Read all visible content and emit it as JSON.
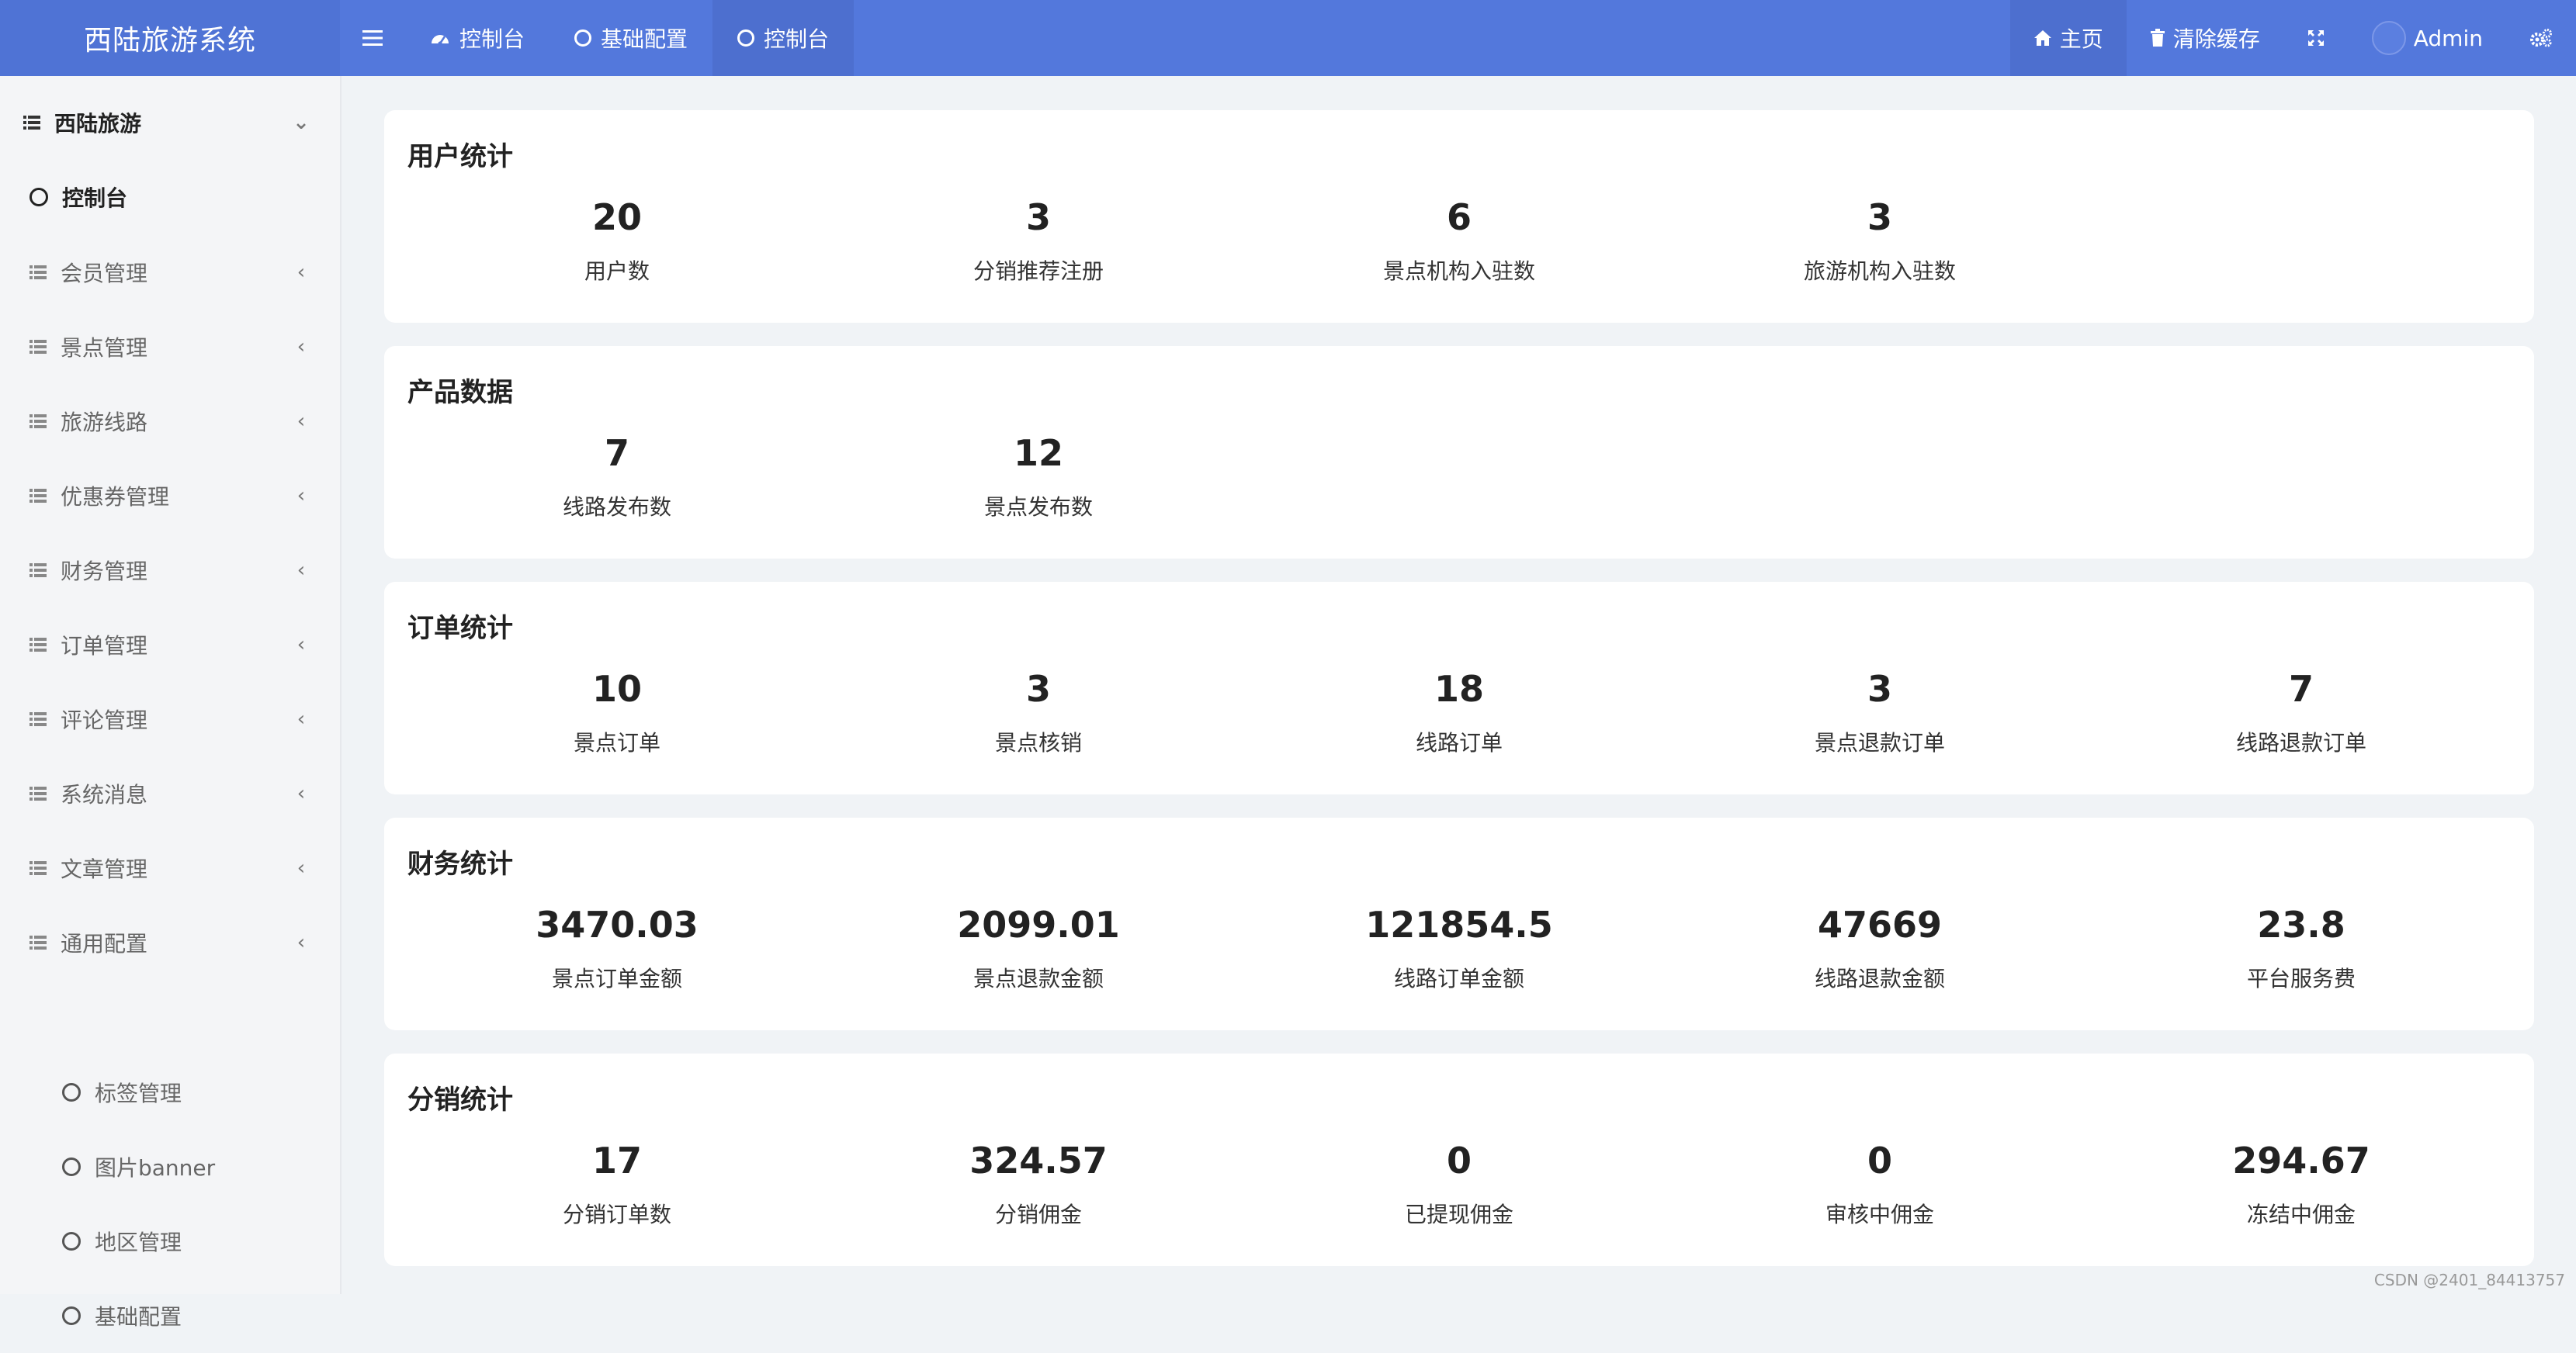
{
  "app": {
    "title": "西陆旅游系统"
  },
  "header": {
    "tabs": [
      {
        "label": "控制台",
        "icon": "dashboard-icon"
      },
      {
        "label": "基础配置",
        "icon": "circle-icon"
      },
      {
        "label": "控制台",
        "icon": "circle-icon"
      }
    ],
    "right": {
      "home": "主页",
      "clear_cache": "清除缓存",
      "user": "Admin"
    }
  },
  "sidebar": {
    "group": "西陆旅游",
    "current": "控制台",
    "items": [
      "会员管理",
      "景点管理",
      "旅游线路",
      "优惠券管理",
      "财务管理",
      "订单管理",
      "评论管理",
      "系统消息",
      "文章管理",
      "通用配置"
    ],
    "subitems": [
      "标签管理",
      "图片banner",
      "地区管理",
      "基础配置"
    ]
  },
  "cards": [
    {
      "title": "用户统计",
      "stats": [
        {
          "value": "20",
          "label": "用户数"
        },
        {
          "value": "3",
          "label": "分销推荐注册"
        },
        {
          "value": "6",
          "label": "景点机构入驻数"
        },
        {
          "value": "3",
          "label": "旅游机构入驻数"
        }
      ]
    },
    {
      "title": "产品数据",
      "stats": [
        {
          "value": "7",
          "label": "线路发布数"
        },
        {
          "value": "12",
          "label": "景点发布数"
        }
      ]
    },
    {
      "title": "订单统计",
      "stats": [
        {
          "value": "10",
          "label": "景点订单"
        },
        {
          "value": "3",
          "label": "景点核销"
        },
        {
          "value": "18",
          "label": "线路订单"
        },
        {
          "value": "3",
          "label": "景点退款订单"
        },
        {
          "value": "7",
          "label": "线路退款订单"
        }
      ]
    },
    {
      "title": "财务统计",
      "stats": [
        {
          "value": "3470.03",
          "label": "景点订单金额"
        },
        {
          "value": "2099.01",
          "label": "景点退款金额"
        },
        {
          "value": "121854.5",
          "label": "线路订单金额"
        },
        {
          "value": "47669",
          "label": "线路退款金额"
        },
        {
          "value": "23.8",
          "label": "平台服务费"
        }
      ]
    },
    {
      "title": "分销统计",
      "stats": [
        {
          "value": "17",
          "label": "分销订单数"
        },
        {
          "value": "324.57",
          "label": "分销佣金"
        },
        {
          "value": "0",
          "label": "已提现佣金"
        },
        {
          "value": "0",
          "label": "审核中佣金"
        },
        {
          "value": "294.67",
          "label": "冻结中佣金"
        }
      ]
    }
  ],
  "watermark": "CSDN @2401_84413757",
  "colors": {
    "header": "#5378dc",
    "logo_bg": "#4f73d5",
    "active_tab": "#4d6fcf",
    "background": "#f0f3f6"
  }
}
